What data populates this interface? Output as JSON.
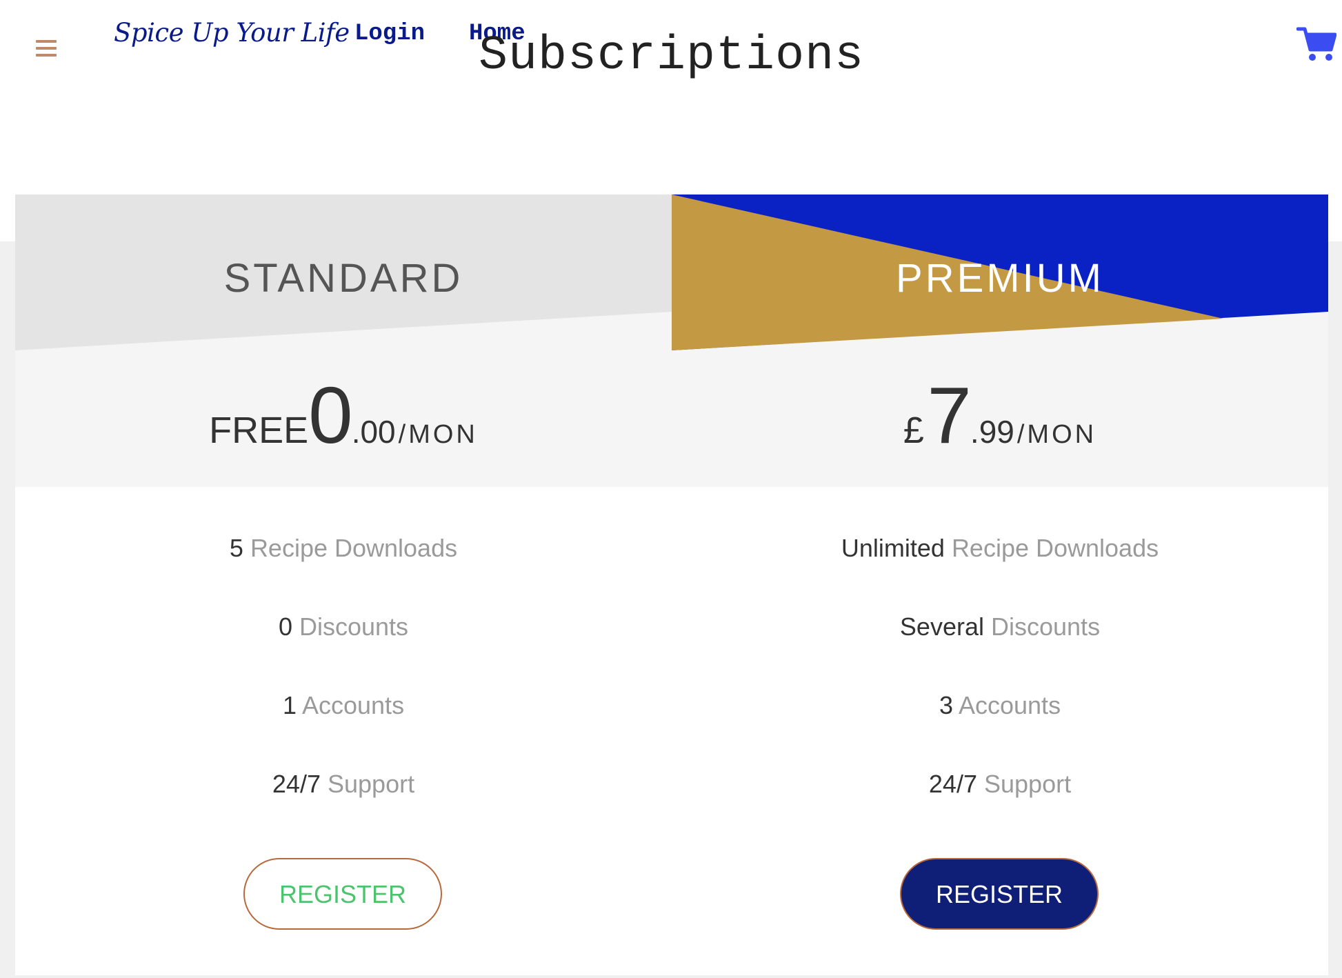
{
  "header": {
    "brand": "Spice Up Your Life",
    "nav": {
      "login": "Login",
      "home": "Home"
    },
    "title": "Subscriptions",
    "menu_icon": "hamburger-menu-icon",
    "cart_icon": "shopping-cart-icon"
  },
  "colors": {
    "brand_text": "#0a1a8a",
    "premium_blue": "#0a22c4",
    "premium_gold": "#c39944",
    "standard_grey": "#e4e4e4",
    "register_border": "#b8693c",
    "register_standard_text": "#4cc46e",
    "register_premium_bg": "#0f1f78",
    "cart": "#3b4cf0",
    "menu": "#c08a6a"
  },
  "plans": [
    {
      "name": "STANDARD",
      "price": {
        "prefix": "FREE",
        "integer": "0",
        "decimal": ".00",
        "period": "/MON"
      },
      "features": [
        {
          "value": "5",
          "label": "Recipe Downloads"
        },
        {
          "value": "0",
          "label": "Discounts"
        },
        {
          "value": "1",
          "label": "Accounts"
        },
        {
          "value": "24/7",
          "label": "Support"
        }
      ],
      "button": "REGISTER"
    },
    {
      "name": "PREMIUM",
      "price": {
        "prefix": "£",
        "integer": "7",
        "decimal": ".99",
        "period": "/MON"
      },
      "features": [
        {
          "value": "Unlimited",
          "label": "Recipe Downloads"
        },
        {
          "value": "Several",
          "label": "Discounts"
        },
        {
          "value": "3",
          "label": "Accounts"
        },
        {
          "value": "24/7",
          "label": "Support"
        }
      ],
      "button": "REGISTER"
    }
  ]
}
